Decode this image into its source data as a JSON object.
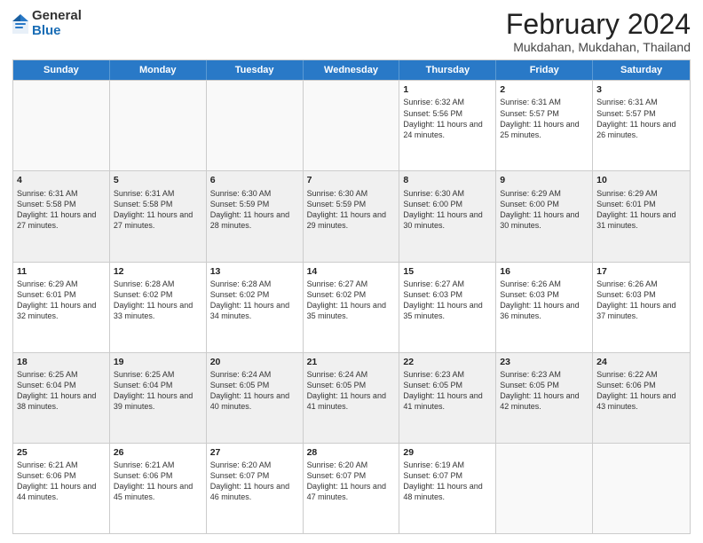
{
  "header": {
    "logo_general": "General",
    "logo_blue": "Blue",
    "title": "February 2024",
    "subtitle": "Mukdahan, Mukdahan, Thailand"
  },
  "days": [
    "Sunday",
    "Monday",
    "Tuesday",
    "Wednesday",
    "Thursday",
    "Friday",
    "Saturday"
  ],
  "rows": [
    [
      {
        "num": "",
        "info": ""
      },
      {
        "num": "",
        "info": ""
      },
      {
        "num": "",
        "info": ""
      },
      {
        "num": "",
        "info": ""
      },
      {
        "num": "1",
        "info": "Sunrise: 6:32 AM\nSunset: 5:56 PM\nDaylight: 11 hours and 24 minutes."
      },
      {
        "num": "2",
        "info": "Sunrise: 6:31 AM\nSunset: 5:57 PM\nDaylight: 11 hours and 25 minutes."
      },
      {
        "num": "3",
        "info": "Sunrise: 6:31 AM\nSunset: 5:57 PM\nDaylight: 11 hours and 26 minutes."
      }
    ],
    [
      {
        "num": "4",
        "info": "Sunrise: 6:31 AM\nSunset: 5:58 PM\nDaylight: 11 hours and 27 minutes."
      },
      {
        "num": "5",
        "info": "Sunrise: 6:31 AM\nSunset: 5:58 PM\nDaylight: 11 hours and 27 minutes."
      },
      {
        "num": "6",
        "info": "Sunrise: 6:30 AM\nSunset: 5:59 PM\nDaylight: 11 hours and 28 minutes."
      },
      {
        "num": "7",
        "info": "Sunrise: 6:30 AM\nSunset: 5:59 PM\nDaylight: 11 hours and 29 minutes."
      },
      {
        "num": "8",
        "info": "Sunrise: 6:30 AM\nSunset: 6:00 PM\nDaylight: 11 hours and 30 minutes."
      },
      {
        "num": "9",
        "info": "Sunrise: 6:29 AM\nSunset: 6:00 PM\nDaylight: 11 hours and 30 minutes."
      },
      {
        "num": "10",
        "info": "Sunrise: 6:29 AM\nSunset: 6:01 PM\nDaylight: 11 hours and 31 minutes."
      }
    ],
    [
      {
        "num": "11",
        "info": "Sunrise: 6:29 AM\nSunset: 6:01 PM\nDaylight: 11 hours and 32 minutes."
      },
      {
        "num": "12",
        "info": "Sunrise: 6:28 AM\nSunset: 6:02 PM\nDaylight: 11 hours and 33 minutes."
      },
      {
        "num": "13",
        "info": "Sunrise: 6:28 AM\nSunset: 6:02 PM\nDaylight: 11 hours and 34 minutes."
      },
      {
        "num": "14",
        "info": "Sunrise: 6:27 AM\nSunset: 6:02 PM\nDaylight: 11 hours and 35 minutes."
      },
      {
        "num": "15",
        "info": "Sunrise: 6:27 AM\nSunset: 6:03 PM\nDaylight: 11 hours and 35 minutes."
      },
      {
        "num": "16",
        "info": "Sunrise: 6:26 AM\nSunset: 6:03 PM\nDaylight: 11 hours and 36 minutes."
      },
      {
        "num": "17",
        "info": "Sunrise: 6:26 AM\nSunset: 6:03 PM\nDaylight: 11 hours and 37 minutes."
      }
    ],
    [
      {
        "num": "18",
        "info": "Sunrise: 6:25 AM\nSunset: 6:04 PM\nDaylight: 11 hours and 38 minutes."
      },
      {
        "num": "19",
        "info": "Sunrise: 6:25 AM\nSunset: 6:04 PM\nDaylight: 11 hours and 39 minutes."
      },
      {
        "num": "20",
        "info": "Sunrise: 6:24 AM\nSunset: 6:05 PM\nDaylight: 11 hours and 40 minutes."
      },
      {
        "num": "21",
        "info": "Sunrise: 6:24 AM\nSunset: 6:05 PM\nDaylight: 11 hours and 41 minutes."
      },
      {
        "num": "22",
        "info": "Sunrise: 6:23 AM\nSunset: 6:05 PM\nDaylight: 11 hours and 41 minutes."
      },
      {
        "num": "23",
        "info": "Sunrise: 6:23 AM\nSunset: 6:05 PM\nDaylight: 11 hours and 42 minutes."
      },
      {
        "num": "24",
        "info": "Sunrise: 6:22 AM\nSunset: 6:06 PM\nDaylight: 11 hours and 43 minutes."
      }
    ],
    [
      {
        "num": "25",
        "info": "Sunrise: 6:21 AM\nSunset: 6:06 PM\nDaylight: 11 hours and 44 minutes."
      },
      {
        "num": "26",
        "info": "Sunrise: 6:21 AM\nSunset: 6:06 PM\nDaylight: 11 hours and 45 minutes."
      },
      {
        "num": "27",
        "info": "Sunrise: 6:20 AM\nSunset: 6:07 PM\nDaylight: 11 hours and 46 minutes."
      },
      {
        "num": "28",
        "info": "Sunrise: 6:20 AM\nSunset: 6:07 PM\nDaylight: 11 hours and 47 minutes."
      },
      {
        "num": "29",
        "info": "Sunrise: 6:19 AM\nSunset: 6:07 PM\nDaylight: 11 hours and 48 minutes."
      },
      {
        "num": "",
        "info": ""
      },
      {
        "num": "",
        "info": ""
      }
    ]
  ]
}
